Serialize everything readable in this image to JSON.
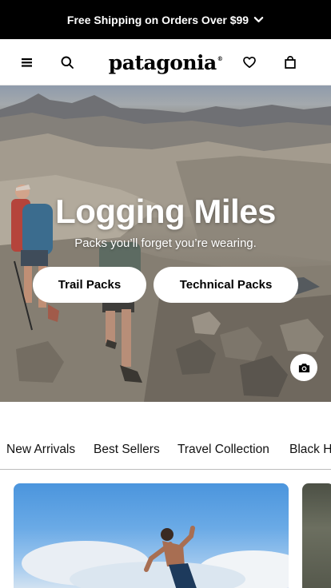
{
  "promo": {
    "text": "Free Shipping on Orders Over $99",
    "chevron_icon": "chevron-down-icon"
  },
  "header": {
    "logo": "patagonia",
    "logo_mark": "®",
    "icons": [
      "menu-icon",
      "search-icon",
      "heart-icon",
      "bag-icon"
    ]
  },
  "hero": {
    "title": "Logging Miles",
    "subtitle": "Packs you’ll forget you’re wearing.",
    "buttons": [
      {
        "label": "Trail Packs"
      },
      {
        "label": "Technical Packs"
      }
    ],
    "camera_icon": "camera-icon"
  },
  "categories": [
    "New Arrivals",
    "Best Sellers",
    "Travel Collection",
    "Black H"
  ],
  "colors": {
    "promo_bg": "#000000",
    "accent": "#000000",
    "page_bg": "#ffffff"
  }
}
